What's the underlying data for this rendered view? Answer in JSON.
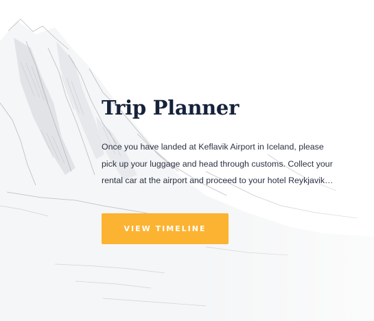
{
  "hero": {
    "title": "Trip Planner",
    "description": "Once you have landed at Keflavik Airport in Iceland, please\npick up your luggage and head through customs. Collect your\nrental car at the airport and proceed to your hotel Reykjavik…",
    "cta_label": "VIEW TIMELINE"
  },
  "colors": {
    "title": "#16223a",
    "text": "#2a3142",
    "cta_background": "#fbb331",
    "cta_text": "#ffffff",
    "sketch": "#b9bcc0"
  }
}
